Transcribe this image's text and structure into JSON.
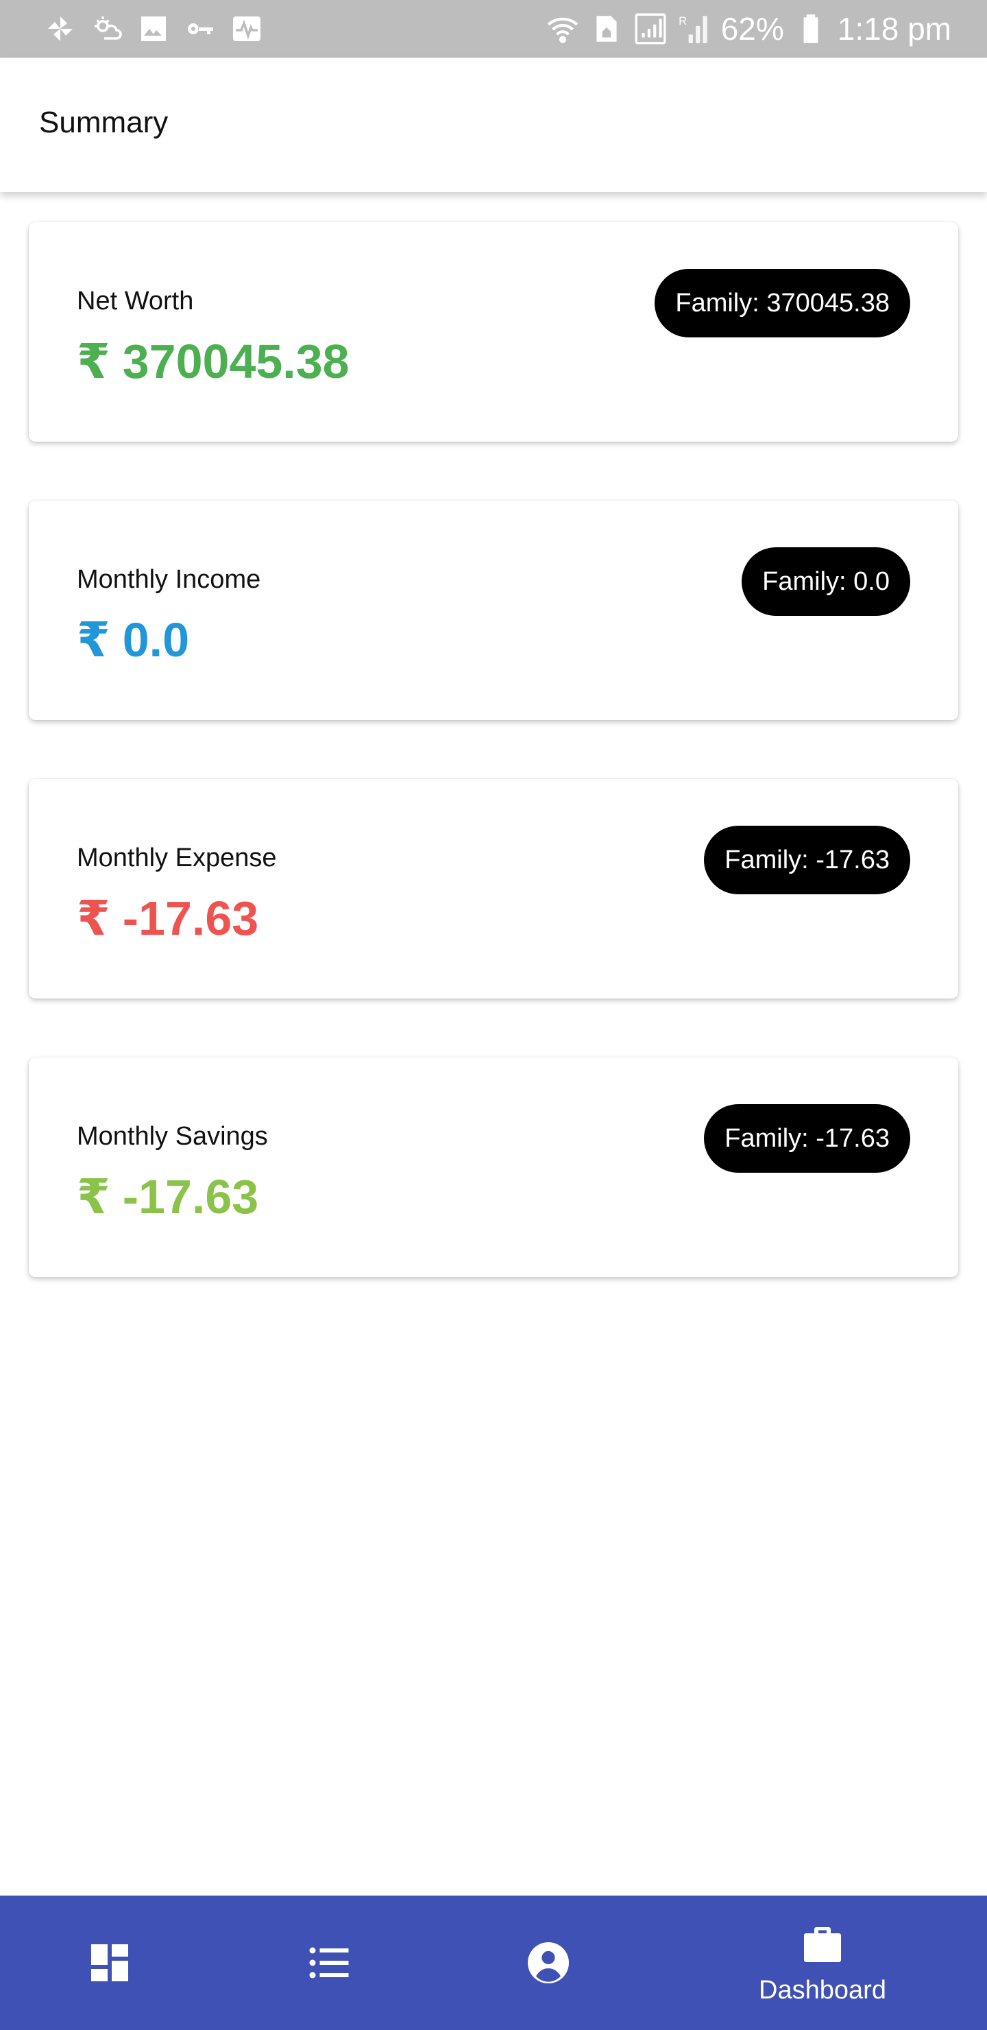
{
  "status_bar": {
    "battery": "62%",
    "time": "1:18 pm",
    "left_icons": [
      "pinwheel-icon",
      "weather-icon",
      "image-icon",
      "key-icon",
      "activity-icon"
    ],
    "right_icons": [
      "wifi-icon",
      "home-sim-icon",
      "signal-icon",
      "roaming-signal-icon",
      "battery-icon"
    ]
  },
  "app_bar": {
    "title": "Summary"
  },
  "currency_symbol": "₹",
  "cards": [
    {
      "title": "Net Worth",
      "value": "370045.38",
      "family": "Family: 370045.38",
      "color": "#4caf50"
    },
    {
      "title": "Monthly Income",
      "value": "0.0",
      "family": "Family: 0.0",
      "color": "#2196d8"
    },
    {
      "title": "Monthly Expense",
      "value": "-17.63",
      "family": "Family: -17.63",
      "color": "#ef5350"
    },
    {
      "title": "Monthly Savings",
      "value": "-17.63",
      "family": "Family: -17.63",
      "color": "#8bc34a"
    }
  ],
  "bottom_nav": {
    "background": "#3f51b5",
    "items": [
      {
        "icon": "dashboard-grid-icon",
        "label": ""
      },
      {
        "icon": "list-icon",
        "label": ""
      },
      {
        "icon": "account-circle-icon",
        "label": ""
      },
      {
        "icon": "briefcase-icon",
        "label": "Dashboard",
        "active": true
      }
    ]
  }
}
